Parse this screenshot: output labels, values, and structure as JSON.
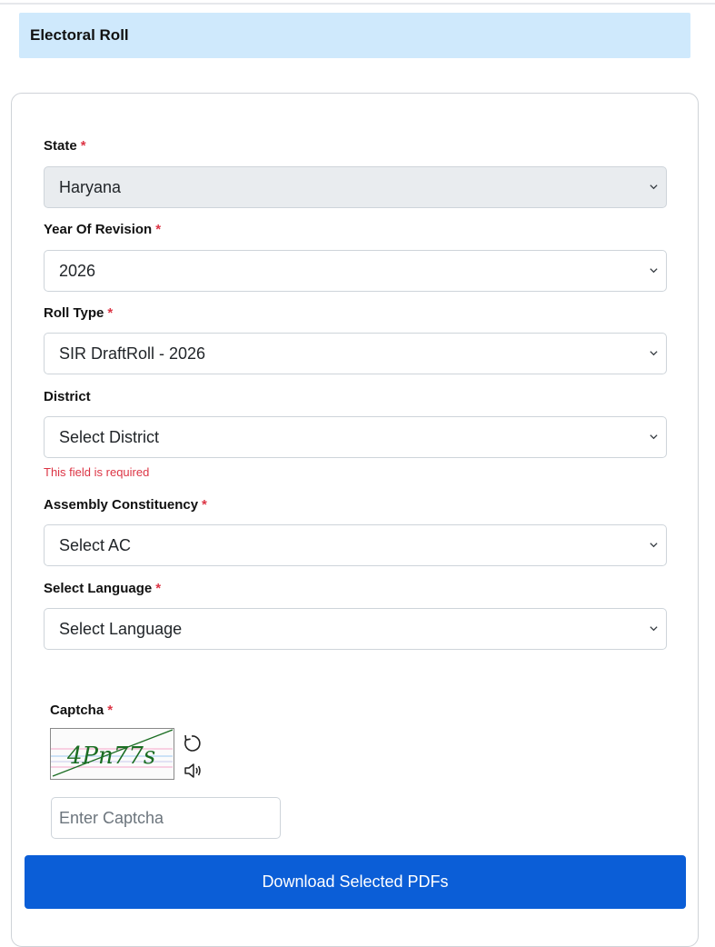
{
  "header": {
    "title": "Electoral Roll"
  },
  "form": {
    "state": {
      "label": "State",
      "required_mark": "*",
      "value": "Haryana"
    },
    "year": {
      "label": "Year Of Revision",
      "required_mark": "*",
      "value": "2026"
    },
    "roll_type": {
      "label": "Roll Type",
      "required_mark": "*",
      "value": "SIR DraftRoll - 2026"
    },
    "district": {
      "label": "District",
      "value": "Select District",
      "error": "This field is required"
    },
    "ac": {
      "label": "Assembly Constituency",
      "required_mark": "*",
      "value": "Select AC"
    },
    "language": {
      "label": "Select Language",
      "required_mark": "*",
      "value": "Select Language"
    },
    "captcha": {
      "label": "Captcha",
      "required_mark": "*",
      "image_text": "4Pn77s",
      "placeholder": "Enter Captcha"
    },
    "download_label": "Download Selected PDFs"
  },
  "icons": {
    "refresh": "refresh-icon",
    "audio": "audio-icon",
    "chevron": "chevron-down-icon"
  },
  "colors": {
    "header_bg": "#cfe9fc",
    "required": "#dc3545",
    "button": "#0b5ed7",
    "disabled_select": "#e9ecef"
  }
}
